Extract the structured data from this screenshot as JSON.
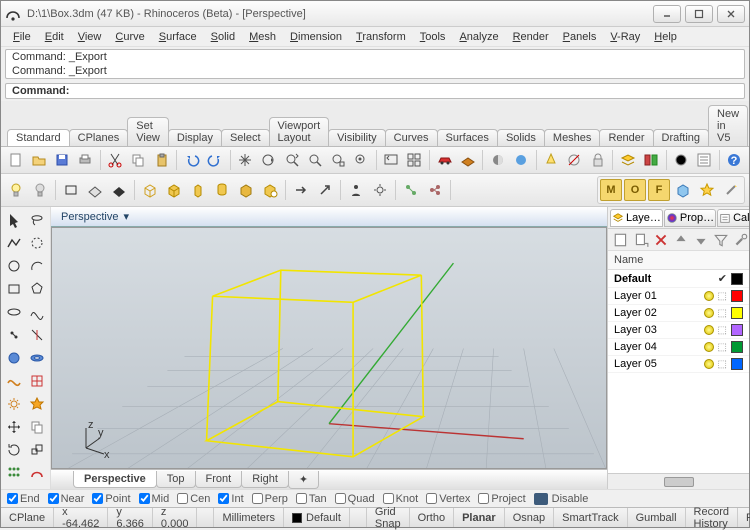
{
  "title": "D:\\1\\Box.3dm (47 KB) - Rhinoceros (Beta) - [Perspective]",
  "menu": [
    "File",
    "Edit",
    "View",
    "Curve",
    "Surface",
    "Solid",
    "Mesh",
    "Dimension",
    "Transform",
    "Tools",
    "Analyze",
    "Render",
    "Panels",
    "V-Ray",
    "Help"
  ],
  "cmd_history": [
    "Command: _Export",
    "Command: _Export"
  ],
  "cmd_prompt": "Command:",
  "tabs": [
    "Standard",
    "CPlanes",
    "Set View",
    "Display",
    "Select",
    "Viewport Layout",
    "Visibility",
    "Curves",
    "Surfaces",
    "Solids",
    "Meshes",
    "Render",
    "Drafting",
    "New in V5"
  ],
  "active_tab": 0,
  "vp_label": "Perspective",
  "vp_tabs": [
    "Perspective",
    "Top",
    "Front",
    "Right"
  ],
  "vp_active": 0,
  "rtabs": [
    "Laye…",
    "Prop…",
    "Calc…"
  ],
  "rtab_active": 0,
  "layer_header": "Name",
  "layers": [
    {
      "name": "Default",
      "default": true,
      "check": true,
      "color": "#000000"
    },
    {
      "name": "Layer 01",
      "color": "#ff0000"
    },
    {
      "name": "Layer 02",
      "color": "#ffff00"
    },
    {
      "name": "Layer 03",
      "color": "#b266ff"
    },
    {
      "name": "Layer 04",
      "color": "#009933"
    },
    {
      "name": "Layer 05",
      "color": "#0066ff"
    }
  ],
  "osnaps": [
    {
      "label": "End",
      "on": true
    },
    {
      "label": "Near",
      "on": true
    },
    {
      "label": "Point",
      "on": true
    },
    {
      "label": "Mid",
      "on": true
    },
    {
      "label": "Cen",
      "on": false
    },
    {
      "label": "Int",
      "on": true
    },
    {
      "label": "Perp",
      "on": false
    },
    {
      "label": "Tan",
      "on": false
    },
    {
      "label": "Quad",
      "on": false
    },
    {
      "label": "Knot",
      "on": false
    },
    {
      "label": "Vertex",
      "on": false
    },
    {
      "label": "Project",
      "on": false
    }
  ],
  "osnap_disable": "Disable",
  "status": {
    "cplane": "CPlane",
    "x": "x -64.462",
    "y": "y 6.366",
    "z": "z 0.000",
    "units": "Millimeters",
    "layer": "Default",
    "swatch": "#000000",
    "toggles": [
      "Grid Snap",
      "Ortho",
      "Planar",
      "Osnap",
      "SmartTrack",
      "Gumball",
      "Record History",
      "Filter"
    ],
    "bold": [
      2
    ]
  }
}
